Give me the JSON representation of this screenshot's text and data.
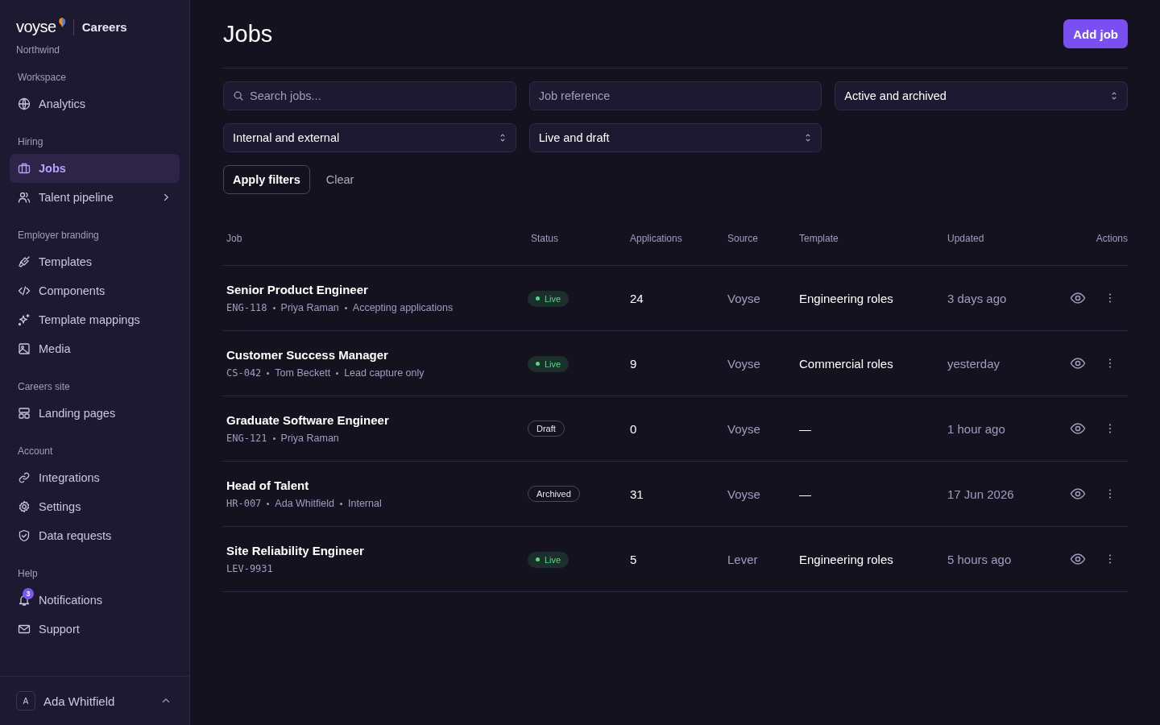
{
  "brand": {
    "logo": "voyse",
    "product": "Careers",
    "org": "Northwind"
  },
  "sidebar": {
    "sections": [
      {
        "title": "Workspace",
        "items": [
          {
            "label": "Analytics",
            "kind": "link",
            "selected": false
          }
        ]
      },
      {
        "title": "Hiring",
        "items": [
          {
            "label": "Jobs",
            "kind": "link",
            "selected": true
          },
          {
            "label": "Talent pipeline",
            "kind": "group",
            "selected": false
          }
        ]
      },
      {
        "title": "Employer branding",
        "items": [
          {
            "label": "Templates",
            "kind": "link",
            "selected": false
          },
          {
            "label": "Components",
            "kind": "link",
            "selected": false
          },
          {
            "label": "Template mappings",
            "kind": "link",
            "selected": false
          },
          {
            "label": "Media",
            "kind": "link",
            "selected": false
          }
        ]
      },
      {
        "title": "Careers site",
        "items": [
          {
            "label": "Landing pages",
            "kind": "link",
            "selected": false
          }
        ]
      },
      {
        "title": "Account",
        "items": [
          {
            "label": "Integrations",
            "kind": "link",
            "selected": false
          },
          {
            "label": "Settings",
            "kind": "link",
            "selected": false
          },
          {
            "label": "Data requests",
            "kind": "link",
            "selected": false
          }
        ]
      },
      {
        "title": "Help",
        "items": [
          {
            "label": "Notifications",
            "kind": "link",
            "selected": false,
            "badge": "3"
          },
          {
            "label": "Support",
            "kind": "link",
            "selected": false
          }
        ]
      }
    ],
    "user": {
      "initial": "A",
      "name": "Ada Whitfield"
    }
  },
  "page": {
    "title": "Jobs",
    "add_button": "Add job"
  },
  "filters": {
    "search": {
      "placeholder": "Search jobs..."
    },
    "reference": {
      "placeholder": "Job reference"
    },
    "selects": [
      {
        "value": "Active and archived"
      },
      {
        "value": "Internal and external"
      },
      {
        "value": "Live and draft"
      }
    ],
    "apply": "Apply filters",
    "clear": "Clear"
  },
  "table": {
    "columns": [
      "Job",
      "Status",
      "Applications",
      "Source",
      "Template",
      "Updated",
      "Actions"
    ],
    "rows": [
      {
        "title": "Senior Product Engineer",
        "ref": "ENG-118",
        "meta": [
          "Priya Raman",
          "Accepting applications"
        ],
        "status": {
          "label": "Live",
          "kind": "live"
        },
        "applications": "24",
        "source": "Voyse",
        "template": "Engineering roles",
        "updated": "3 days ago"
      },
      {
        "title": "Customer Success Manager",
        "ref": "CS-042",
        "meta": [
          "Tom Beckett",
          "Lead capture only"
        ],
        "status": {
          "label": "Live",
          "kind": "live"
        },
        "applications": "9",
        "source": "Voyse",
        "template": "Commercial roles",
        "updated": "yesterday"
      },
      {
        "title": "Graduate Software Engineer",
        "ref": "ENG-121",
        "meta": [
          "Priya Raman"
        ],
        "status": {
          "label": "Draft",
          "kind": "draft"
        },
        "applications": "0",
        "source": "Voyse",
        "template": "—",
        "updated": "1 hour ago"
      },
      {
        "title": "Head of Talent",
        "ref": "HR-007",
        "meta": [
          "Ada Whitfield",
          "Internal"
        ],
        "status": {
          "label": "Archived",
          "kind": "archived"
        },
        "applications": "31",
        "source": "Voyse",
        "template": "—",
        "updated": "17 Jun 2026"
      },
      {
        "title": "Site Reliability Engineer",
        "ref": "LEV-9931",
        "meta": [],
        "status": {
          "label": "Live",
          "kind": "live"
        },
        "applications": "5",
        "source": "Lever",
        "template": "Engineering roles",
        "updated": "5 hours ago"
      }
    ]
  }
}
